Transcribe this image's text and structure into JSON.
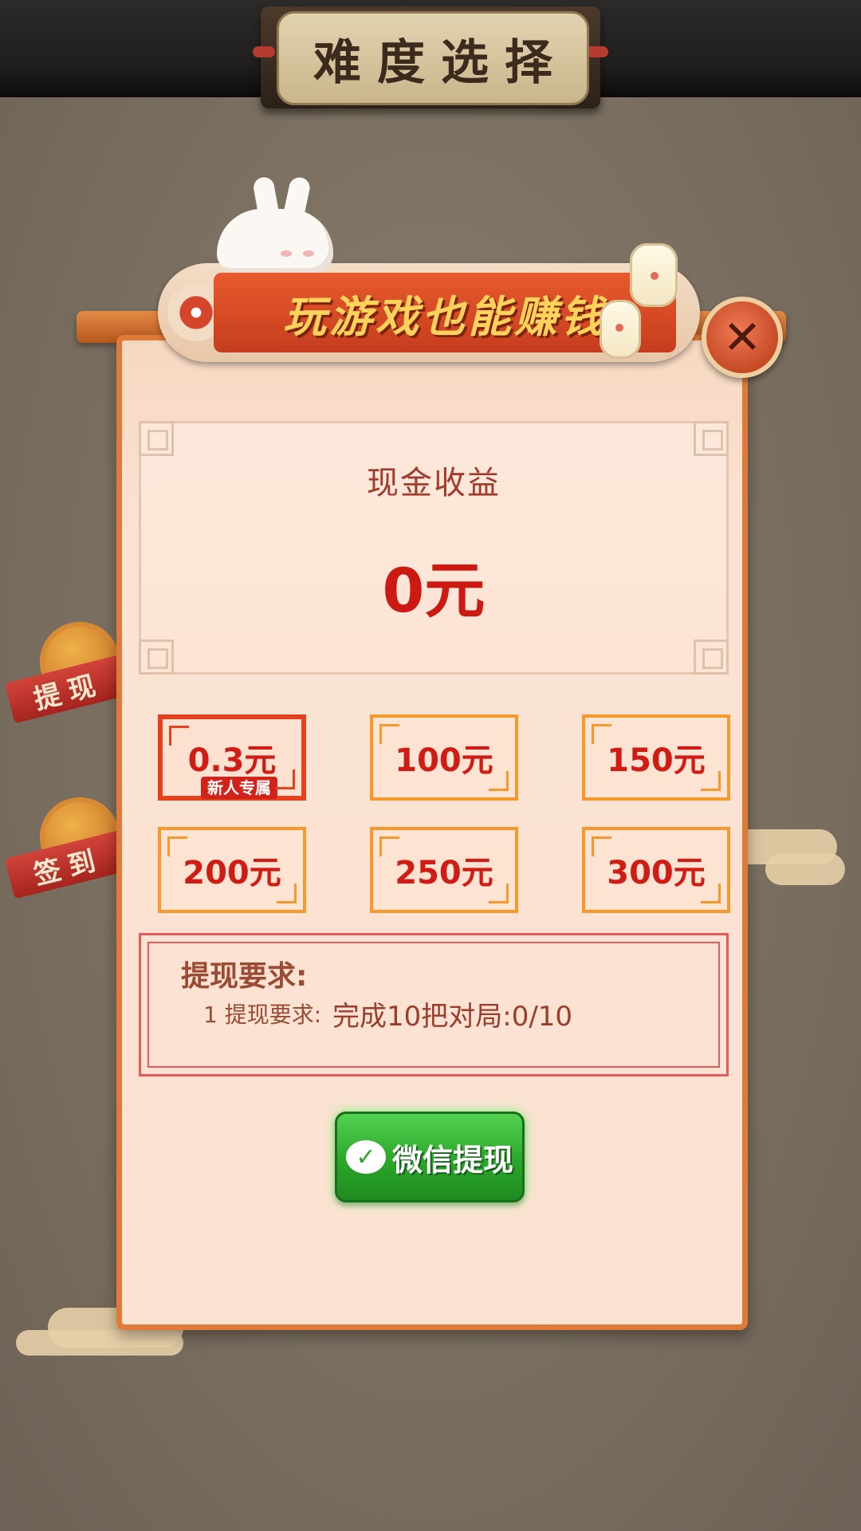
{
  "header": {
    "title": "难度选择"
  },
  "side_buttons": {
    "withdraw_label": "提现",
    "signin_label": "签到"
  },
  "dialog": {
    "banner_text": "玩游戏也能赚钱",
    "close_icon": "✕",
    "earnings": {
      "label": "现金收益",
      "value": "0元"
    },
    "amount_options": [
      {
        "label": "0.3元",
        "tag": "新人专属",
        "selected": true
      },
      {
        "label": "100元"
      },
      {
        "label": "150元"
      },
      {
        "label": "200元"
      },
      {
        "label": "250元"
      },
      {
        "label": "300元"
      }
    ],
    "requirements": {
      "title": "提现要求:",
      "items": [
        {
          "prefix": "1 提现要求:",
          "detail": "完成10把对局:0/10"
        }
      ]
    },
    "wechat_button": {
      "label": "微信提现"
    }
  },
  "colors": {
    "accent_red": "#cc1a12",
    "option_border": "#f7982d",
    "selected_border": "#e2421e",
    "wechat_green": "#2ba62a",
    "panel_border": "#e07a38"
  }
}
